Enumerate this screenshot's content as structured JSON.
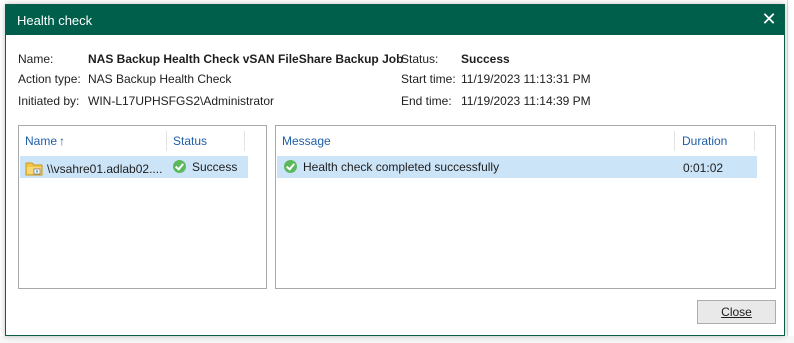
{
  "dialog": {
    "title": "Health check",
    "close_glyph": "✕"
  },
  "info": {
    "name_label": "Name:",
    "name_value": "NAS Backup Health Check vSAN FileShare Backup Job",
    "action_label": "Action type:",
    "action_value": "NAS Backup Health Check",
    "initiated_label": "Initiated by:",
    "initiated_value": "WIN-L17UPHSFGS2\\Administrator",
    "status_label": "Status:",
    "status_value": "Success",
    "start_label": "Start time:",
    "start_value": "11/19/2023 11:13:31 PM",
    "end_label": "End time:",
    "end_value": "11/19/2023 11:14:39 PM"
  },
  "objects": {
    "columns": {
      "name": "Name",
      "sort_arrow": "↑",
      "status": "Status"
    },
    "rows": [
      {
        "name": "\\\\vsahre01.adlab02....",
        "status": "Success"
      }
    ]
  },
  "log": {
    "columns": {
      "message": "Message",
      "duration": "Duration"
    },
    "rows": [
      {
        "message": "Health check completed successfully",
        "duration": "0:01:02"
      }
    ]
  },
  "buttons": {
    "close": "Close"
  },
  "colors": {
    "titlebar": "#005f4b",
    "header_text": "#1f5fa8",
    "selection": "#cce4f7",
    "success": "#5cb85c"
  },
  "icons": [
    "close-icon",
    "sort-ascending-icon",
    "folder-share-icon",
    "success-check-icon"
  ]
}
